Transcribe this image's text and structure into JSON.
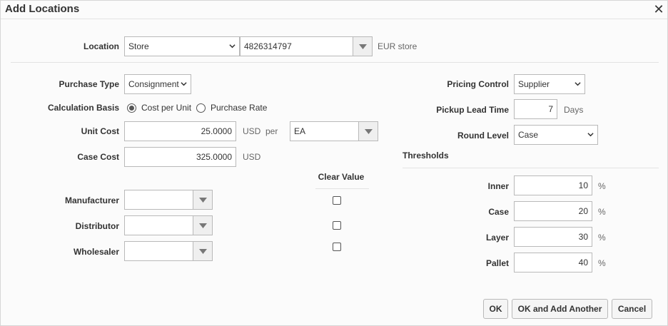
{
  "dialog": {
    "title": "Add Locations",
    "close_glyph": "✕"
  },
  "location": {
    "label": "Location",
    "type_value": "Store",
    "id_value": "4826314797",
    "description": "EUR store"
  },
  "purchase_type": {
    "label": "Purchase Type",
    "value": "Consignment"
  },
  "calculation_basis": {
    "label": "Calculation Basis",
    "options": [
      "Cost per Unit",
      "Purchase Rate"
    ],
    "selected": "Cost per Unit"
  },
  "unit_cost": {
    "label": "Unit Cost",
    "value": "25.0000",
    "currency": "USD",
    "per": "per",
    "uom": "EA"
  },
  "case_cost": {
    "label": "Case Cost",
    "value": "325.0000",
    "currency": "USD"
  },
  "clear_value": {
    "header": "Clear Value"
  },
  "parties": [
    {
      "label": "Manufacturer",
      "value": ""
    },
    {
      "label": "Distributor",
      "value": ""
    },
    {
      "label": "Wholesaler",
      "value": ""
    }
  ],
  "pricing_control": {
    "label": "Pricing Control",
    "value": "Supplier"
  },
  "pickup_lead_time": {
    "label": "Pickup Lead Time",
    "value": "7",
    "unit": "Days"
  },
  "round_level": {
    "label": "Round Level",
    "value": "Case"
  },
  "thresholds": {
    "header": "Thresholds",
    "unit": "%",
    "items": [
      {
        "label": "Inner",
        "value": "10"
      },
      {
        "label": "Case",
        "value": "20"
      },
      {
        "label": "Layer",
        "value": "30"
      },
      {
        "label": "Pallet",
        "value": "40"
      }
    ]
  },
  "buttons": {
    "ok": "OK",
    "ok_add": "OK and Add Another",
    "cancel": "Cancel"
  },
  "colors": {
    "border": "#b9b9b9",
    "background": "#fbfbfb",
    "text": "#333333"
  }
}
